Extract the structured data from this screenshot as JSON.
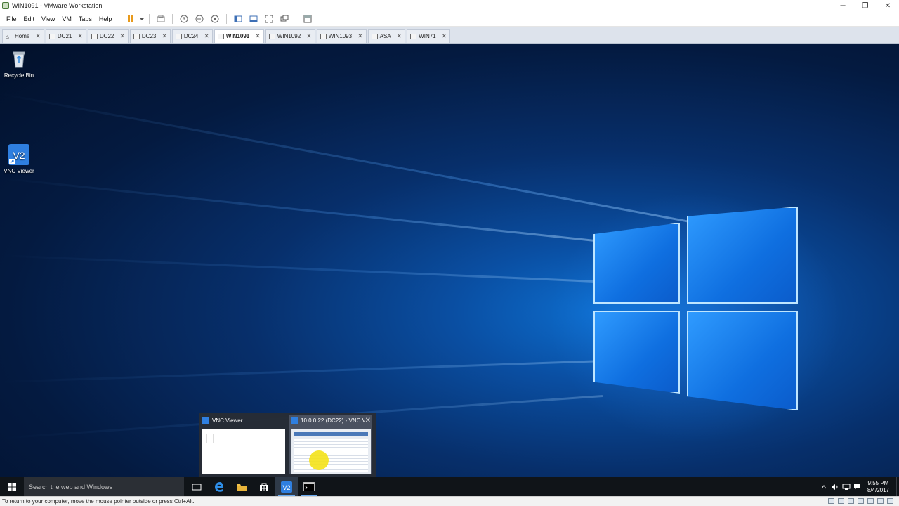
{
  "window": {
    "title": "WIN1091 - VMware Workstation",
    "controls": [
      "─",
      "❐",
      "✕"
    ]
  },
  "menu": {
    "items": [
      "File",
      "Edit",
      "View",
      "VM",
      "Tabs",
      "Help"
    ]
  },
  "tabs": [
    {
      "label": "Home"
    },
    {
      "label": "DC21"
    },
    {
      "label": "DC22"
    },
    {
      "label": "DC23"
    },
    {
      "label": "DC24"
    },
    {
      "label": "WIN1091"
    },
    {
      "label": "WIN1092"
    },
    {
      "label": "WIN1093"
    },
    {
      "label": "ASA"
    },
    {
      "label": "WIN71"
    }
  ],
  "active_tab": "WIN1091",
  "desktop": {
    "icons": [
      {
        "label": "Recycle Bin",
        "icon": "recycle-bin-icon"
      },
      {
        "label": "VNC Viewer",
        "icon": "vnc-viewer-icon"
      }
    ]
  },
  "thumbnails": [
    {
      "title": "VNC Viewer"
    },
    {
      "title": "10.0.0.22 (DC22) - VNC Vi..."
    }
  ],
  "taskbar": {
    "search_placeholder": "Search the web and Windows",
    "time": "9:55 PM",
    "date": "8/4/2017"
  },
  "status": {
    "text": "To return to your computer, move the mouse pointer outside or press Ctrl+Alt."
  },
  "colors": {
    "desktop_blue": "#0a4fa3",
    "taskbar": "#101418",
    "accent": "#2f7fe0"
  }
}
